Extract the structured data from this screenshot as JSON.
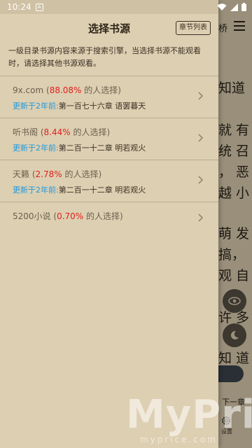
{
  "status_bar": {
    "time": "10:24",
    "notification_glyph": "A"
  },
  "reader": {
    "lines": [
      "知道",
      "就 有",
      "统 召",
      "，  恶",
      "越 小",
      "萌 发",
      "搞，",
      "观 自",
      "许 多",
      "知 道"
    ],
    "next_chapter_label": "下一章",
    "settings_label": "设置",
    "top_char": "桥"
  },
  "watermark": {
    "brand": "MyPri",
    "url": "myprice.com"
  },
  "drawer": {
    "title": "选择书源",
    "chapter_list_label": "章节列表",
    "description": "一级目录书源内容来源于搜索引擎，当选择书源不能观看时，请选择其他书源观看。",
    "update_prefix": "更新于2年前:",
    "sources": [
      {
        "name": "9x.com",
        "percent": "88.08%",
        "suffix": " 的人选择)",
        "chapter": "第一百七十六章 语罢暮天"
      },
      {
        "name": "听书阁",
        "percent": "8.44%",
        "suffix": " 的人选择)",
        "chapter": "第二百一十二章 明若观火"
      },
      {
        "name": "天籁",
        "percent": "2.78%",
        "suffix": " 的人选择)",
        "chapter": "第二百一十二章 明若观火"
      },
      {
        "name": "5200小说",
        "percent": "0.70%",
        "suffix": " 的人选择)",
        "chapter": ""
      }
    ]
  },
  "colors": {
    "accent_blue": "#1e9ae0",
    "percent_red": "#e02020",
    "paper": "#ddcfb1"
  }
}
